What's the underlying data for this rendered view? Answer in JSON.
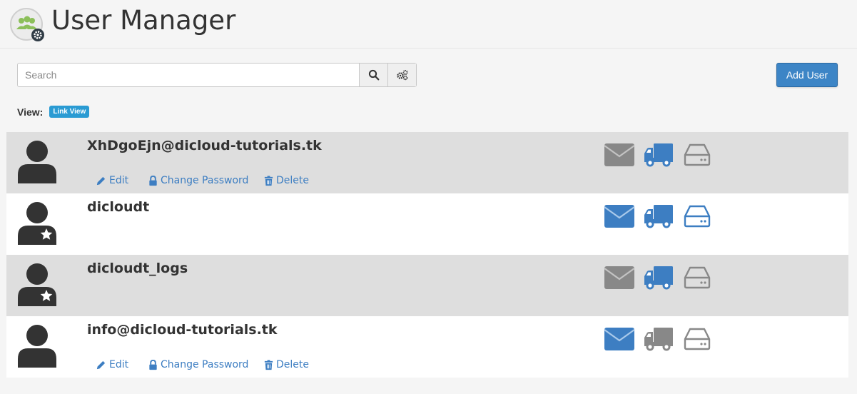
{
  "header": {
    "title": "User Manager",
    "logo_icon": "users-gear-icon"
  },
  "toolbar": {
    "search_placeholder": "Search",
    "search_icon": "search-icon",
    "settings_icon": "gears-icon",
    "add_user_label": "Add User"
  },
  "view": {
    "label": "View:",
    "badge": "Link View"
  },
  "actions": {
    "edit": "Edit",
    "change_password": "Change Password",
    "delete": "Delete"
  },
  "colors": {
    "service_enabled": "#3d7ec2",
    "service_disabled": "#888888",
    "accent": "#3d85c6",
    "badge": "#2a9bd3"
  },
  "users": [
    {
      "username": "XhDgoEjn@dicloud-tutorials.tk",
      "is_system": false,
      "services": {
        "email": false,
        "ftp": true,
        "web_disk": false
      }
    },
    {
      "username": "dicloudt",
      "is_system": true,
      "services": {
        "email": true,
        "ftp": true,
        "web_disk": true
      }
    },
    {
      "username": "dicloudt_logs",
      "is_system": true,
      "services": {
        "email": false,
        "ftp": true,
        "web_disk": false
      }
    },
    {
      "username": "info@dicloud-tutorials.tk",
      "is_system": false,
      "services": {
        "email": true,
        "ftp": false,
        "web_disk": false
      }
    }
  ]
}
